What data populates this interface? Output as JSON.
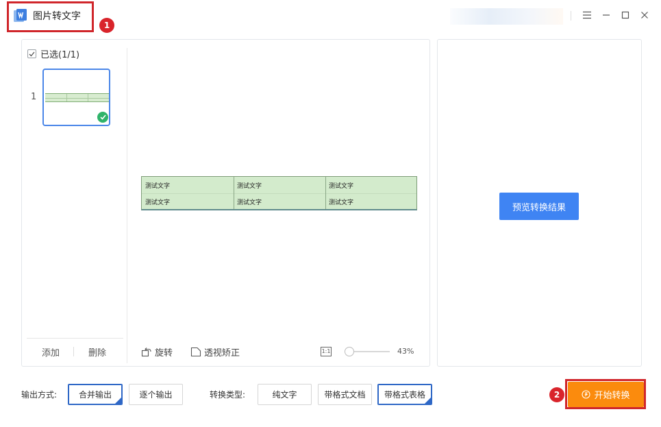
{
  "window": {
    "title": "图片转文字",
    "controls": [
      "menu-icon",
      "minimize-icon",
      "maximize-icon",
      "close-icon"
    ]
  },
  "annotations": {
    "step1": "1",
    "step2": "2",
    "color": "#d0262b"
  },
  "thumbnails": {
    "select_all_label": "已选(1/1)",
    "items": [
      {
        "index": "1",
        "checked": true
      }
    ],
    "add_label": "添加",
    "delete_label": "删除"
  },
  "preview": {
    "table": {
      "rows": [
        [
          "测试文字",
          "测试文字",
          "测试文字"
        ],
        [
          "测试文字",
          "测试文字",
          "测试文字"
        ]
      ]
    },
    "rotate_label": "旋转",
    "perspective_label": "透视矫正",
    "fit_icon_text": "1:1",
    "zoom": "43%"
  },
  "result_panel": {
    "preview_button": "预览转换结果"
  },
  "options": {
    "output_label": "输出方式:",
    "output_modes": [
      {
        "label": "合并输出",
        "selected": true
      },
      {
        "label": "逐个输出",
        "selected": false
      }
    ],
    "type_label": "转换类型:",
    "types": [
      {
        "label": "纯文字",
        "selected": false
      },
      {
        "label": "带格式文档",
        "selected": false
      },
      {
        "label": "带格式表格",
        "selected": true
      }
    ]
  },
  "start_button": "开始转换",
  "colors": {
    "accent": "#3f84f3",
    "start": "#fb8b0d",
    "selected_border": "#2e67c6",
    "success": "#2fb36a"
  }
}
